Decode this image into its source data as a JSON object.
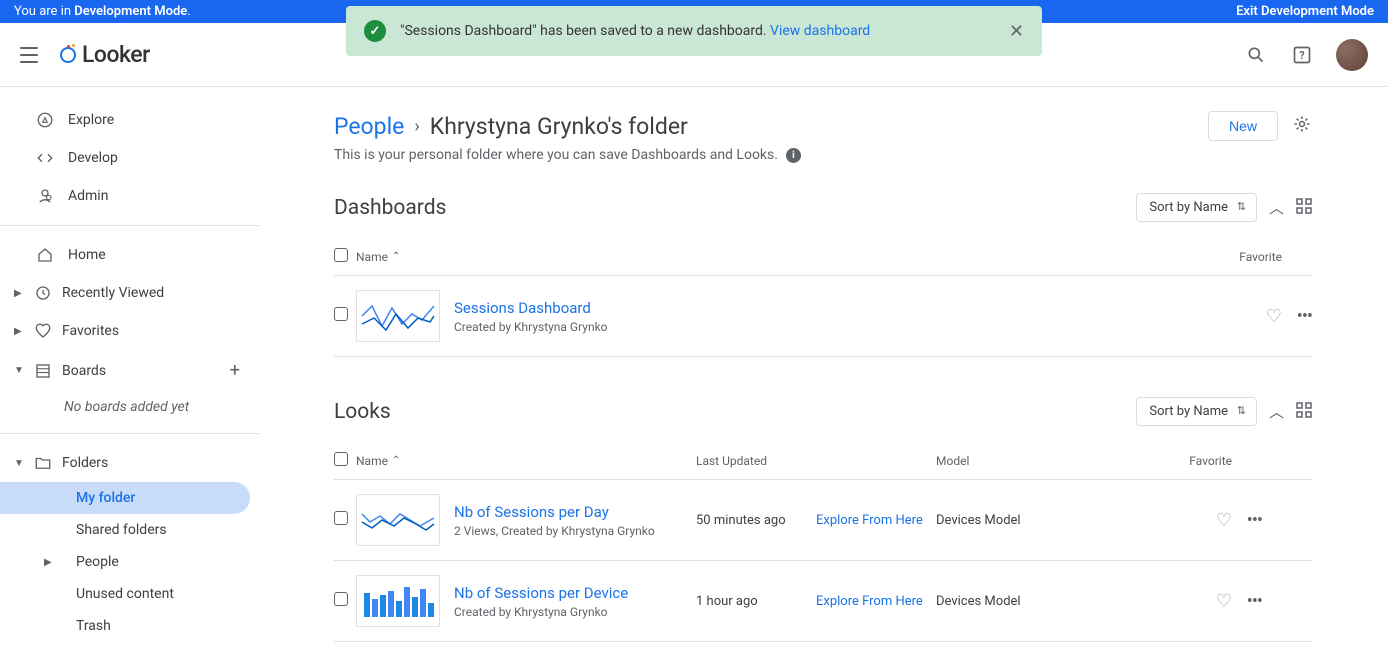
{
  "banner": {
    "prefix": "You are in ",
    "mode": "Development Mode",
    "suffix": ".",
    "exit": "Exit Development Mode"
  },
  "toast": {
    "message": "\"Sessions Dashboard\" has been saved to a new dashboard. ",
    "link": "View dashboard"
  },
  "logo": "Looker",
  "nav": {
    "explore": "Explore",
    "develop": "Develop",
    "admin": "Admin",
    "home": "Home",
    "recent": "Recently Viewed",
    "favorites": "Favorites",
    "boards": "Boards",
    "boards_empty": "No boards added yet",
    "folders": "Folders",
    "myfolder": "My folder",
    "shared": "Shared folders",
    "people": "People",
    "unused": "Unused content",
    "trash": "Trash"
  },
  "breadcrumb": {
    "parent": "People",
    "title": "Khrystyna Grynko's folder",
    "new_btn": "New"
  },
  "desc": "This is your personal folder where you can save Dashboards and Looks.",
  "sections": {
    "dashboards": "Dashboards",
    "looks": "Looks",
    "sort": "Sort by Name",
    "col_name": "Name",
    "col_updated": "Last Updated",
    "col_model": "Model",
    "col_favorite": "Favorite"
  },
  "dashboards": [
    {
      "title": "Sessions Dashboard",
      "subtitle": "Created by Khrystyna Grynko"
    }
  ],
  "looks": [
    {
      "title": "Nb of Sessions per Day",
      "subtitle": "2 Views, Created by Khrystyna Grynko",
      "updated": "50 minutes ago",
      "explore": "Explore From Here",
      "model": "Devices Model"
    },
    {
      "title": "Nb of Sessions per Device",
      "subtitle": "Created by Khrystyna Grynko",
      "updated": "1 hour ago",
      "explore": "Explore From Here",
      "model": "Devices Model"
    }
  ]
}
